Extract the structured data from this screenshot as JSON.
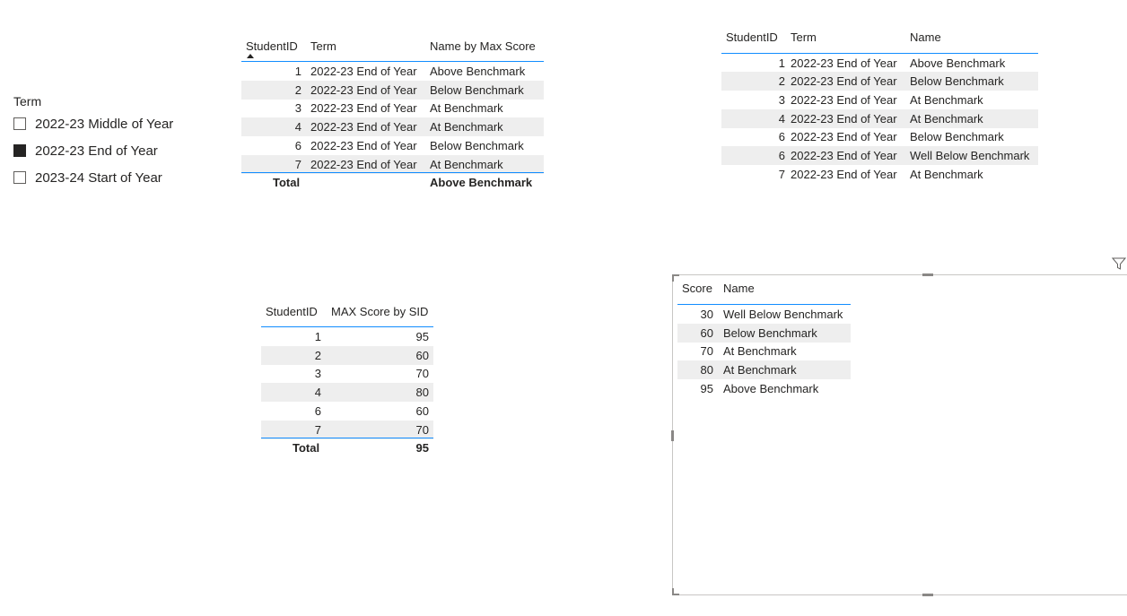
{
  "slicer": {
    "title": "Term",
    "items": [
      {
        "label": "2022-23 Middle of Year",
        "checked": false
      },
      {
        "label": "2022-23 End of Year",
        "checked": true
      },
      {
        "label": "2023-24 Start of Year",
        "checked": false
      }
    ]
  },
  "table1": {
    "headers": [
      "StudentID",
      "Term",
      "Name by Max Score"
    ],
    "rows": [
      [
        "1",
        "2022-23 End of Year",
        "Above Benchmark"
      ],
      [
        "2",
        "2022-23 End of Year",
        "Below Benchmark"
      ],
      [
        "3",
        "2022-23 End of Year",
        "At Benchmark"
      ],
      [
        "4",
        "2022-23 End of Year",
        "At Benchmark"
      ],
      [
        "6",
        "2022-23 End of Year",
        "Below Benchmark"
      ],
      [
        "7",
        "2022-23 End of Year",
        "At Benchmark"
      ]
    ],
    "total_label": "Total",
    "total_value": "Above Benchmark"
  },
  "table2": {
    "headers": [
      "StudentID",
      "Term",
      "Name"
    ],
    "rows": [
      [
        "1",
        "2022-23 End of Year",
        "Above Benchmark"
      ],
      [
        "2",
        "2022-23 End of Year",
        "Below Benchmark"
      ],
      [
        "3",
        "2022-23 End of Year",
        "At Benchmark"
      ],
      [
        "4",
        "2022-23 End of Year",
        "At Benchmark"
      ],
      [
        "6",
        "2022-23 End of Year",
        "Below Benchmark"
      ],
      [
        "6",
        "2022-23 End of Year",
        "Well Below Benchmark"
      ],
      [
        "7",
        "2022-23 End of Year",
        "At Benchmark"
      ]
    ]
  },
  "table3": {
    "headers": [
      "StudentID",
      "MAX Score by SID"
    ],
    "rows": [
      [
        "1",
        "95"
      ],
      [
        "2",
        "60"
      ],
      [
        "3",
        "70"
      ],
      [
        "4",
        "80"
      ],
      [
        "6",
        "60"
      ],
      [
        "7",
        "70"
      ]
    ],
    "total_label": "Total",
    "total_value": "95"
  },
  "table4": {
    "headers": [
      "Score",
      "Name"
    ],
    "rows": [
      [
        "30",
        "Well Below Benchmark"
      ],
      [
        "60",
        "Below Benchmark"
      ],
      [
        "70",
        "At Benchmark"
      ],
      [
        "80",
        "At Benchmark"
      ],
      [
        "95",
        "Above Benchmark"
      ]
    ]
  },
  "icons": {
    "filter": "filter-icon",
    "sort": "sort-ascending-icon"
  }
}
